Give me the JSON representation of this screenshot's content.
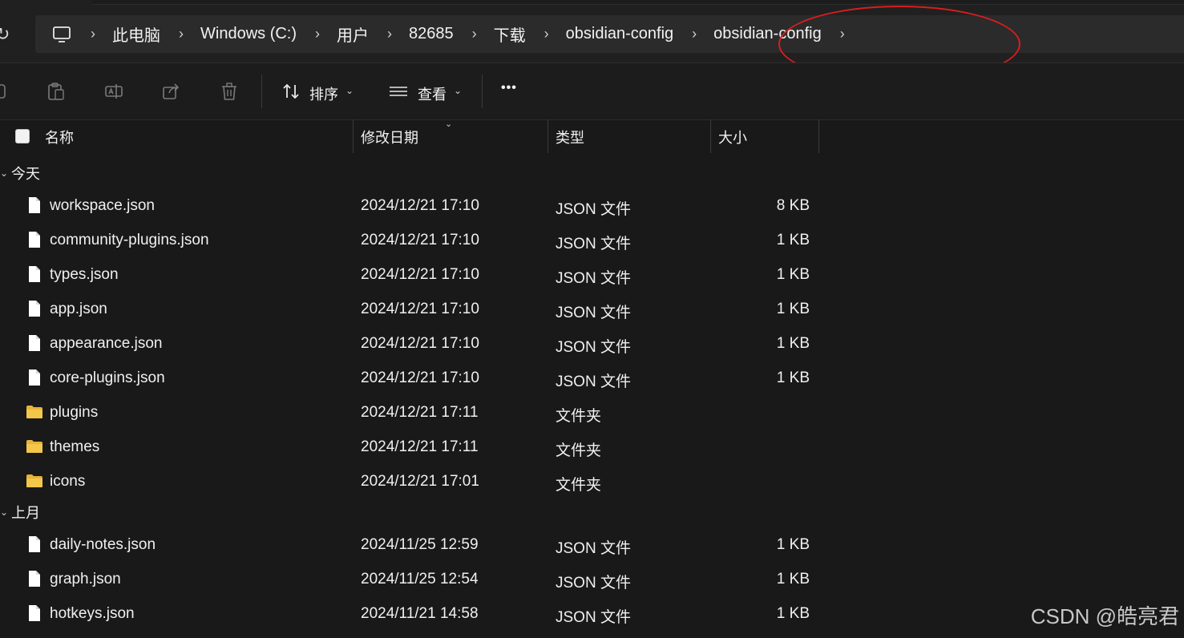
{
  "toolbar_top": {
    "refresh_glyph": "↻"
  },
  "breadcrumb": [
    "此电脑",
    "Windows (C:)",
    "用户",
    "82685",
    "下载",
    "obsidian-config",
    "obsidian-config"
  ],
  "breadcrumb_separator": "›",
  "command_bar": {
    "sort_label": "排序",
    "view_label": "查看",
    "more_label": "•••"
  },
  "columns": {
    "name": "名称",
    "date": "修改日期",
    "type": "类型",
    "size": "大小"
  },
  "groups": [
    {
      "label": "今天",
      "items": [
        {
          "name": "workspace.json",
          "date": "2024/12/21 17:10",
          "type": "JSON 文件",
          "size": "8 KB",
          "kind": "file"
        },
        {
          "name": "community-plugins.json",
          "date": "2024/12/21 17:10",
          "type": "JSON 文件",
          "size": "1 KB",
          "kind": "file"
        },
        {
          "name": "types.json",
          "date": "2024/12/21 17:10",
          "type": "JSON 文件",
          "size": "1 KB",
          "kind": "file"
        },
        {
          "name": "app.json",
          "date": "2024/12/21 17:10",
          "type": "JSON 文件",
          "size": "1 KB",
          "kind": "file"
        },
        {
          "name": "appearance.json",
          "date": "2024/12/21 17:10",
          "type": "JSON 文件",
          "size": "1 KB",
          "kind": "file"
        },
        {
          "name": "core-plugins.json",
          "date": "2024/12/21 17:10",
          "type": "JSON 文件",
          "size": "1 KB",
          "kind": "file"
        },
        {
          "name": "plugins",
          "date": "2024/12/21 17:11",
          "type": "文件夹",
          "size": "",
          "kind": "folder"
        },
        {
          "name": "themes",
          "date": "2024/12/21 17:11",
          "type": "文件夹",
          "size": "",
          "kind": "folder"
        },
        {
          "name": "icons",
          "date": "2024/12/21 17:01",
          "type": "文件夹",
          "size": "",
          "kind": "folder"
        }
      ]
    },
    {
      "label": "上月",
      "items": [
        {
          "name": "daily-notes.json",
          "date": "2024/11/25 12:59",
          "type": "JSON 文件",
          "size": "1 KB",
          "kind": "file"
        },
        {
          "name": "graph.json",
          "date": "2024/11/25 12:54",
          "type": "JSON 文件",
          "size": "1 KB",
          "kind": "file"
        },
        {
          "name": "hotkeys.json",
          "date": "2024/11/21 14:58",
          "type": "JSON 文件",
          "size": "1 KB",
          "kind": "file"
        }
      ]
    }
  ],
  "watermark": "CSDN @皓亮君",
  "colors": {
    "background": "#191919",
    "annotation": "#d81e1e",
    "folder": "#f3c74a"
  }
}
